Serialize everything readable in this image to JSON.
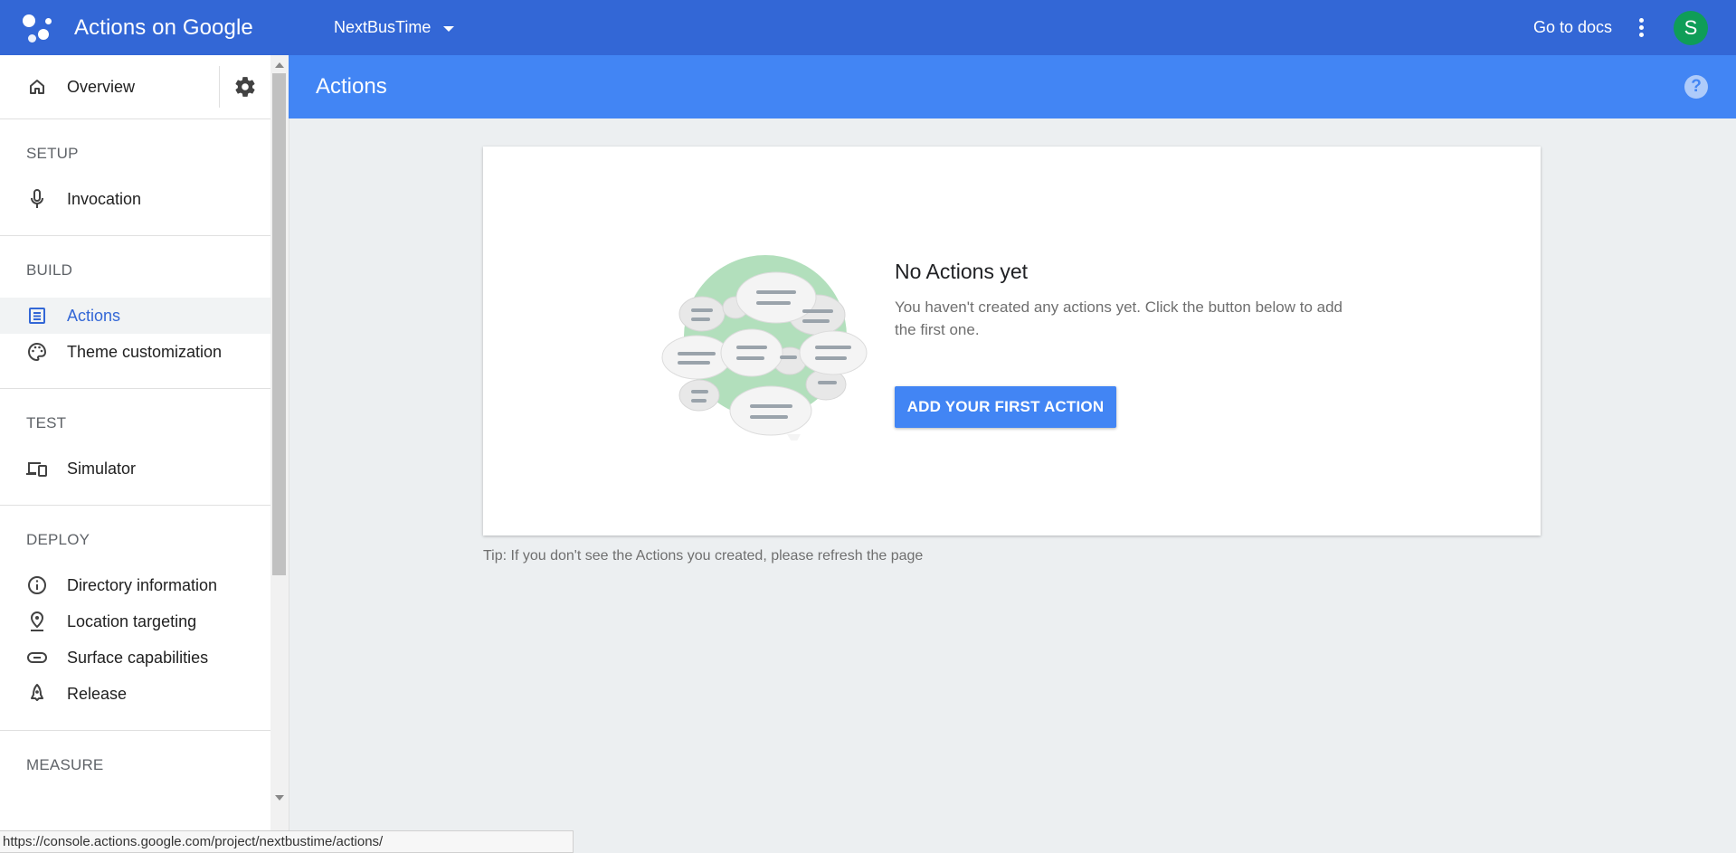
{
  "topbar": {
    "app_title": "Actions on Google",
    "project_name": "NextBusTime",
    "docs_label": "Go to docs",
    "avatar_initial": "S",
    "brand_color": "#3367d6"
  },
  "sidebar": {
    "overview_label": "Overview",
    "sections": {
      "setup": {
        "title": "SETUP",
        "items": [
          {
            "label": "Invocation",
            "icon": "mic-icon"
          }
        ]
      },
      "build": {
        "title": "BUILD",
        "items": [
          {
            "label": "Actions",
            "icon": "list-icon",
            "active": true
          },
          {
            "label": "Theme customization",
            "icon": "palette-icon"
          }
        ]
      },
      "test": {
        "title": "TEST",
        "items": [
          {
            "label": "Simulator",
            "icon": "devices-icon"
          }
        ]
      },
      "deploy": {
        "title": "DEPLOY",
        "items": [
          {
            "label": "Directory information",
            "icon": "info-icon"
          },
          {
            "label": "Location targeting",
            "icon": "location-pin-icon"
          },
          {
            "label": "Surface capabilities",
            "icon": "surface-icon"
          },
          {
            "label": "Release",
            "icon": "rocket-icon"
          }
        ]
      },
      "measure": {
        "title": "MEASURE"
      }
    }
  },
  "page": {
    "title": "Actions",
    "header_color": "#4285f4"
  },
  "empty_state": {
    "title": "No Actions yet",
    "description": "You haven't created any actions yet. Click the button below to add the first one.",
    "button_label": "ADD YOUR FIRST ACTION",
    "tip": "Tip: If you don't see the Actions you created, please refresh the page"
  },
  "status_bar": {
    "url": "https://console.actions.google.com/project/nextbustime/actions/"
  }
}
